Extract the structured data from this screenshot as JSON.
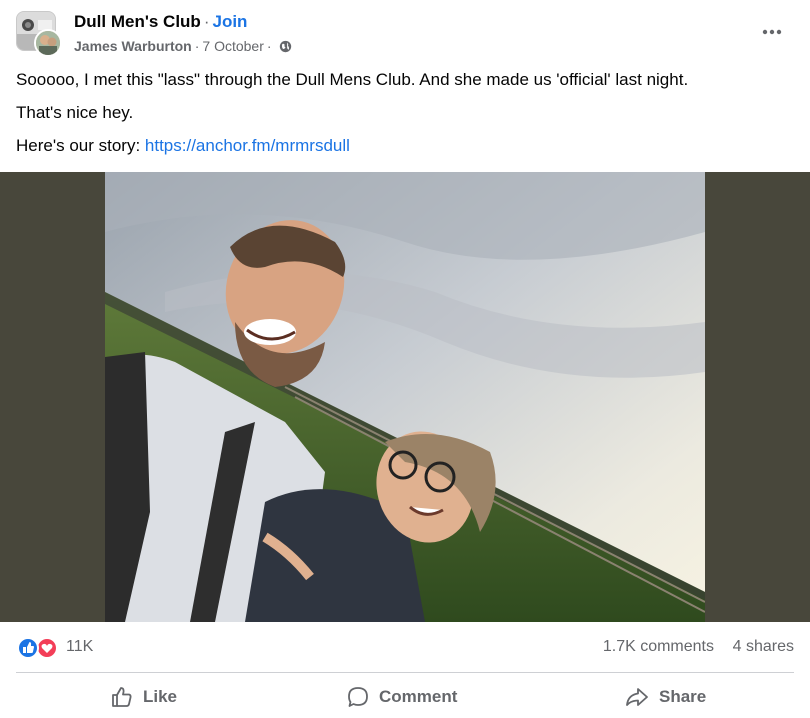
{
  "post": {
    "group_name": "Dull Men's Club",
    "separator": "·",
    "join_label": "Join",
    "author": "James Warburton",
    "date": "7 October",
    "privacy_icon": "globe-icon",
    "more_icon": "more-options-icon",
    "text": {
      "line1": "Sooooo, I met this \"lass\" through the Dull Mens Club. And she made us 'official' last night.",
      "line2": "That's nice hey.",
      "line3_prefix": "Here's our story: ",
      "line3_link": "https://anchor.fm/mrmrsdull"
    }
  },
  "stats": {
    "reaction_icons": [
      "like-reaction-icon",
      "love-reaction-icon"
    ],
    "reaction_count": "11K",
    "comments": "1.7K comments",
    "shares": "4 shares"
  },
  "actions": {
    "like": "Like",
    "comment": "Comment",
    "share": "Share"
  },
  "colors": {
    "accent": "#1b74e4",
    "secondary_text": "#65676b",
    "photo_band": "#48473b",
    "love": "#f33e58"
  }
}
